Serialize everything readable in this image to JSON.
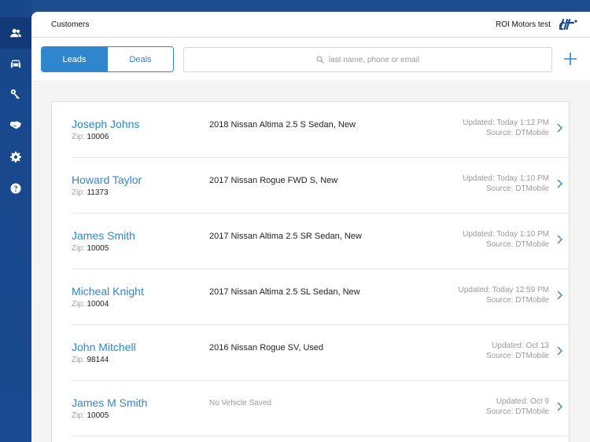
{
  "sidebar": {
    "items": [
      {
        "icon": "people-icon",
        "active": true
      },
      {
        "icon": "car-icon",
        "active": false
      },
      {
        "icon": "key-tag-icon",
        "active": false
      },
      {
        "icon": "handshake-icon",
        "active": false
      },
      {
        "icon": "gear-icon",
        "active": false
      },
      {
        "icon": "help-icon",
        "active": false
      }
    ]
  },
  "header": {
    "title": "Customers",
    "dealer": "ROI Motors test",
    "logo_icon": "dt-logo-icon"
  },
  "toolbar": {
    "tabs": [
      {
        "label": "Leads",
        "selected": true
      },
      {
        "label": "Deals",
        "selected": false
      }
    ],
    "search": {
      "placeholder": "last name, phone or email",
      "value": ""
    },
    "add_icon": "plus-icon"
  },
  "leads": [
    {
      "name": "Joseph Johns",
      "zip_label": "Zip:",
      "zip": "10006",
      "vehicle": "2018 Nissan Altima 2.5 S Sedan, New",
      "updated": "Updated: Today 1:12 PM",
      "source": "Source: DTMobile"
    },
    {
      "name": "Howard Taylor",
      "zip_label": "Zip:",
      "zip": "11373",
      "vehicle": "2017 Nissan Rogue FWD S, New",
      "updated": "Updated: Today 1:10 PM",
      "source": "Source: DTMobile"
    },
    {
      "name": "James Smith",
      "zip_label": "Zip:",
      "zip": "10005",
      "vehicle": "2017 Nissan Altima 2.5 SR Sedan, New",
      "updated": "Updated: Today 1:10 PM",
      "source": "Source: DTMobile"
    },
    {
      "name": "Micheal Knight",
      "zip_label": "Zip:",
      "zip": "10004",
      "vehicle": "2017 Nissan Altima 2.5 SL Sedan, New",
      "updated": "Updated: Today 12:59 PM",
      "source": "Source: DTMobile"
    },
    {
      "name": "John Mitchell",
      "zip_label": "Zip:",
      "zip": "98144",
      "vehicle": "2016 Nissan Rogue SV, Used",
      "updated": "Updated: Oct 13",
      "source": "Source: DTMobile"
    },
    {
      "name": "James M Smith",
      "zip_label": "Zip:",
      "zip": "10005",
      "vehicle": "No Vehicle Saved",
      "vehicle_empty": true,
      "updated": "Updated: Oct 9",
      "source": "Source: DTMobile"
    }
  ],
  "colors": {
    "sidebar": "#1a4a8f",
    "accent": "#2f86cc",
    "muted_text": "#9a9a9a",
    "background": "#f4f4f4"
  }
}
